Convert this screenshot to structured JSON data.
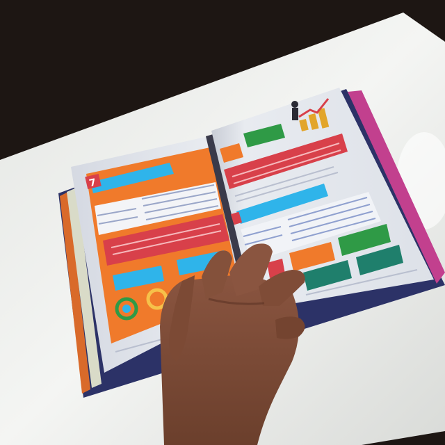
{
  "photo": {
    "subject": "open-textbook-on-table-with-hand",
    "colors": {
      "background_dark": "#1d1613",
      "table_white": "#eef0ee",
      "page_white": "#e9ecf1",
      "orange_panel": "#f07a2b",
      "red_box": "#d8404a",
      "blue_tab": "#2fb4ea",
      "green_box": "#2f9a46",
      "teal_box": "#1f7f6c",
      "navy_cover": "#2c3267",
      "skin": "#7a4a34"
    }
  },
  "book": {
    "left_page": {
      "figure_number": "7"
    },
    "right_page": {}
  }
}
